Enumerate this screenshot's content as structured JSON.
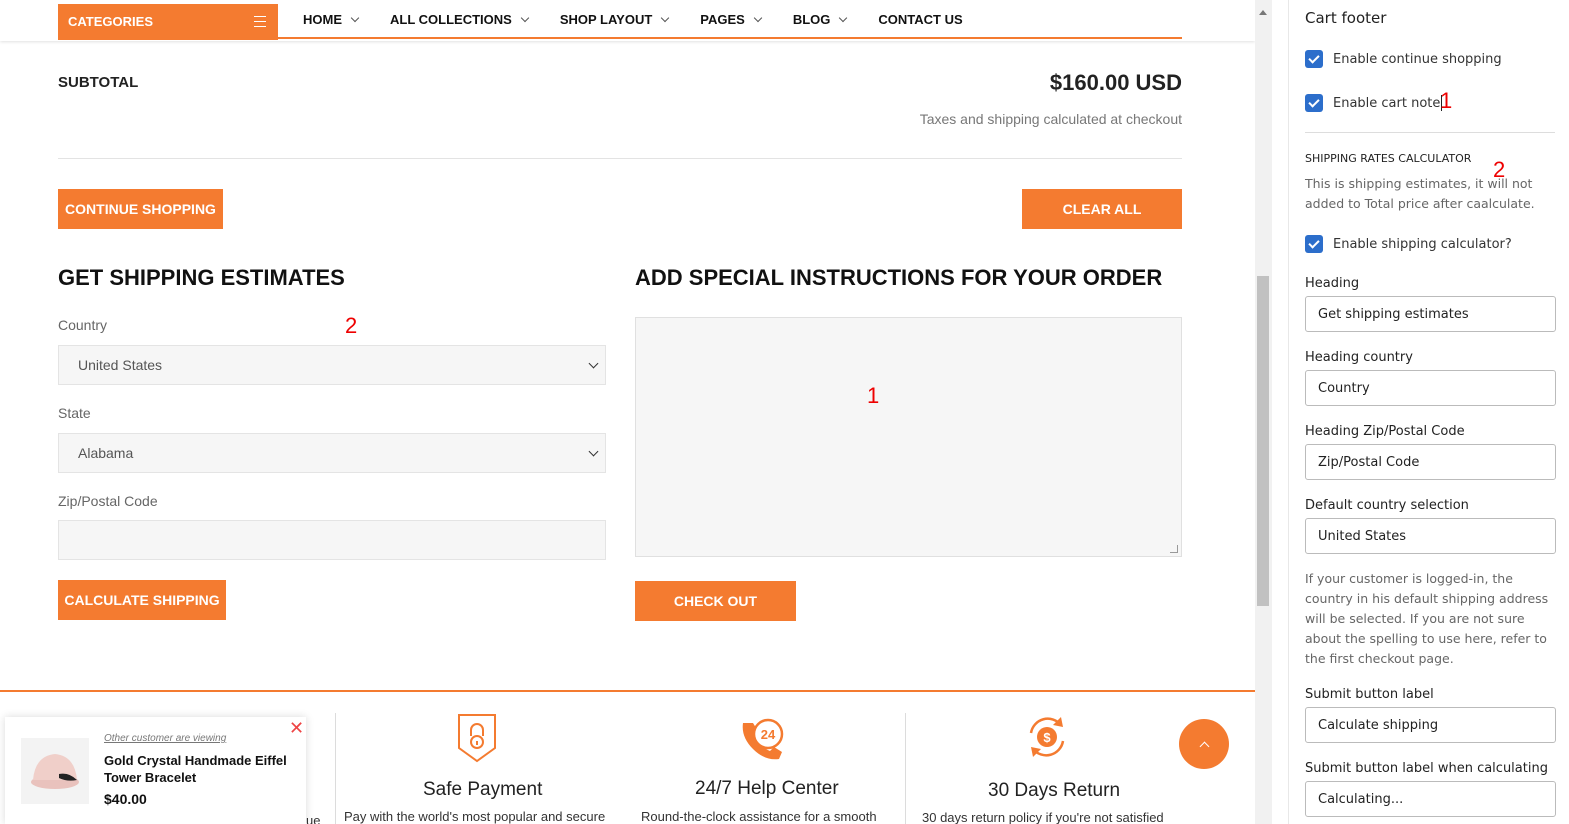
{
  "nav": {
    "categories_label": "CATEGORIES",
    "menu": [
      {
        "label": "HOME",
        "has_dropdown": true
      },
      {
        "label": "ALL COLLECTIONS",
        "has_dropdown": true
      },
      {
        "label": "SHOP LAYOUT",
        "has_dropdown": true
      },
      {
        "label": "PAGES",
        "has_dropdown": true
      },
      {
        "label": "BLOG",
        "has_dropdown": true
      },
      {
        "label": "CONTACT US",
        "has_dropdown": false
      }
    ]
  },
  "cart": {
    "subtotal_label": "SUBTOTAL",
    "subtotal_value": "$160.00 USD",
    "tax_note": "Taxes and shipping calculated at checkout",
    "continue_label": "CONTINUE SHOPPING",
    "clear_label": "CLEAR ALL",
    "checkout_label": "CHECK OUT"
  },
  "shipping": {
    "heading": "GET SHIPPING ESTIMATES",
    "country_label": "Country",
    "country_value": "United States",
    "state_label": "State",
    "state_value": "Alabama",
    "zip_label": "Zip/Postal Code",
    "zip_value": "",
    "calc_label": "CALCULATE SHIPPING"
  },
  "instructions": {
    "heading": "ADD SPECIAL INSTRUCTIONS FOR YOUR ORDER",
    "note_value": ""
  },
  "annotations": {
    "one": "1",
    "two": "2"
  },
  "features": [
    {
      "title": "Safe Payment",
      "desc": "Pay with the world's most popular and secure",
      "icon": "shield-lock-icon"
    },
    {
      "title": "24/7 Help Center",
      "desc": "Round-the-clock assistance for a smooth",
      "icon": "phone-24-icon"
    },
    {
      "title": "30 Days Return",
      "desc": "30 days return policy if you're not satisfied",
      "icon": "money-return-icon"
    }
  ],
  "popup": {
    "viewing_text": "Other customer are viewing",
    "product_name": "Gold Crystal Handmade Eiffel Tower Bracelet",
    "price": "$40.00",
    "partial_text": "ue"
  },
  "panel": {
    "title": "Cart footer",
    "enable_continue": {
      "label": "Enable continue shopping",
      "checked": true
    },
    "enable_note": {
      "label": "Enable cart note",
      "checked": true
    },
    "subhead": "SHIPPING RATES CALCULATOR",
    "calc_help": "This is shipping estimates, it will not added to Total price after caalculate.",
    "enable_calc": {
      "label": "Enable shipping calculator?",
      "checked": true
    },
    "heading_label": "Heading",
    "heading_value": "Get shipping estimates",
    "heading_country_label": "Heading country",
    "heading_country_value": "Country",
    "heading_zip_label": "Heading Zip/Postal Code",
    "heading_zip_value": "Zip/Postal Code",
    "default_country_label": "Default country selection",
    "default_country_value": "United States",
    "default_country_help": "If your customer is logged-in, the country in his default shipping address will be selected. If you are not sure about the spelling to use here, refer to the first checkout page.",
    "submit_label": "Submit button label",
    "submit_value": "Calculate shipping",
    "submit_calc_label": "Submit button label when calculating",
    "submit_calc_value": "Calculating..."
  },
  "colors": {
    "accent": "#f47b30",
    "checkbox": "#2c6ecb",
    "annotation": "#e00000"
  }
}
